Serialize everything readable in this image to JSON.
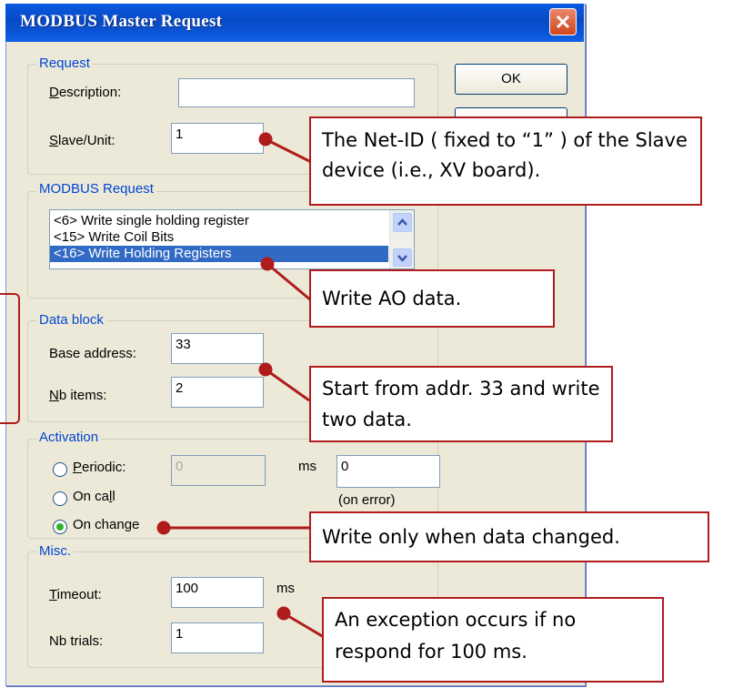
{
  "dialog": {
    "title": "MODBUS Master Request",
    "ok_label": "OK",
    "request": {
      "group_label": "Request",
      "description_label": "Description:",
      "description_value": "",
      "slave_label": "Slave/Unit:",
      "slave_value": "1"
    },
    "modbus_request": {
      "group_label": "MODBUS Request",
      "items": [
        "<6> Write single holding register",
        "<15> Write Coil Bits",
        "<16> Write Holding Registers"
      ],
      "selected_index": 2
    },
    "data_block": {
      "group_label": "Data block",
      "base_address_label": "Base address:",
      "base_address_value": "33",
      "nb_items_label": "Nb items:",
      "nb_items_value": "2"
    },
    "activation": {
      "group_label": "Activation",
      "periodic_label": "Periodic:",
      "periodic_value": "0",
      "ms_label": "ms",
      "error_value": "0",
      "on_error_label": "(on error)",
      "on_call_label": "On call",
      "on_change_label": "On change",
      "selected": "On change"
    },
    "misc": {
      "group_label": "Misc.",
      "timeout_label": "Timeout:",
      "timeout_value": "100",
      "timeout_unit": "ms",
      "nb_trials_label": "Nb trials:",
      "nb_trials_value": "1"
    }
  },
  "callouts": {
    "net_id": "The Net-ID ( fixed to “1” ) of the Slave device (i.e., XV board).",
    "write_ao": "Write AO data.",
    "start_addr": "Start from addr. 33 and write two data.",
    "write_change": "Write only when data changed.",
    "exception": "An exception occurs if no respond for 100 ms."
  },
  "colors": {
    "callout_border": "#b01c1c",
    "titlebar": "#0a5ae0",
    "group_label": "#0046d5",
    "selection": "#316ac5"
  }
}
